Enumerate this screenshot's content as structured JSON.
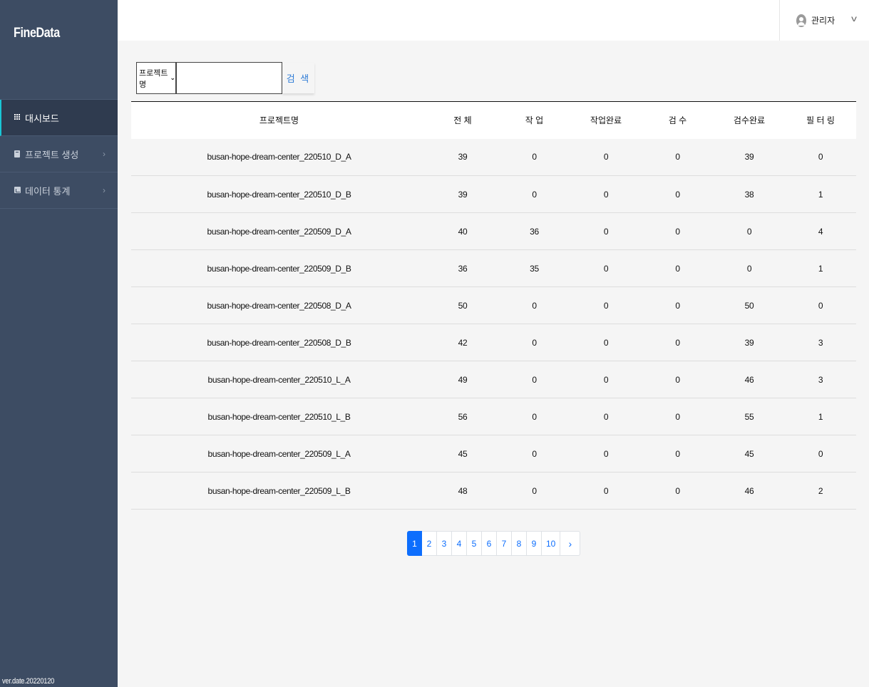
{
  "brand": "FineData",
  "sidebar": {
    "items": [
      {
        "label": "대시보드",
        "icon": "grid-icon"
      },
      {
        "label": "프로젝트 생성",
        "icon": "book-icon"
      },
      {
        "label": "데이터 통계",
        "icon": "chart-icon"
      }
    ],
    "version": "ver.date.20220120"
  },
  "header": {
    "user_name": "관리자",
    "user_chevron": "v"
  },
  "search": {
    "select_value": "프로젝트명",
    "input_value": "",
    "button_label": "검 색"
  },
  "table": {
    "headers": [
      "프로젝트명",
      "전 체",
      "작 업",
      "작업완료",
      "검 수",
      "검수완료",
      "필 터 링"
    ],
    "rows": [
      [
        "busan-hope-dream-center_220510_D_A",
        "39",
        "0",
        "0",
        "0",
        "39",
        "0"
      ],
      [
        "busan-hope-dream-center_220510_D_B",
        "39",
        "0",
        "0",
        "0",
        "38",
        "1"
      ],
      [
        "busan-hope-dream-center_220509_D_A",
        "40",
        "36",
        "0",
        "0",
        "0",
        "4"
      ],
      [
        "busan-hope-dream-center_220509_D_B",
        "36",
        "35",
        "0",
        "0",
        "0",
        "1"
      ],
      [
        "busan-hope-dream-center_220508_D_A",
        "50",
        "0",
        "0",
        "0",
        "50",
        "0"
      ],
      [
        "busan-hope-dream-center_220508_D_B",
        "42",
        "0",
        "0",
        "0",
        "39",
        "3"
      ],
      [
        "busan-hope-dream-center_220510_L_A",
        "49",
        "0",
        "0",
        "0",
        "46",
        "3"
      ],
      [
        "busan-hope-dream-center_220510_L_B",
        "56",
        "0",
        "0",
        "0",
        "55",
        "1"
      ],
      [
        "busan-hope-dream-center_220509_L_A",
        "45",
        "0",
        "0",
        "0",
        "45",
        "0"
      ],
      [
        "busan-hope-dream-center_220509_L_B",
        "48",
        "0",
        "0",
        "0",
        "46",
        "2"
      ]
    ]
  },
  "pagination": {
    "pages": [
      "1",
      "2",
      "3",
      "4",
      "5",
      "6",
      "7",
      "8",
      "9",
      "10"
    ],
    "active_page": "1",
    "next_label": "›"
  },
  "colors": {
    "sidebar_bg": "#3d4c63",
    "active_indicator": "#19c6d6",
    "accent_blue": "#0d6efd",
    "search_button_text": "#2f7cd6"
  }
}
